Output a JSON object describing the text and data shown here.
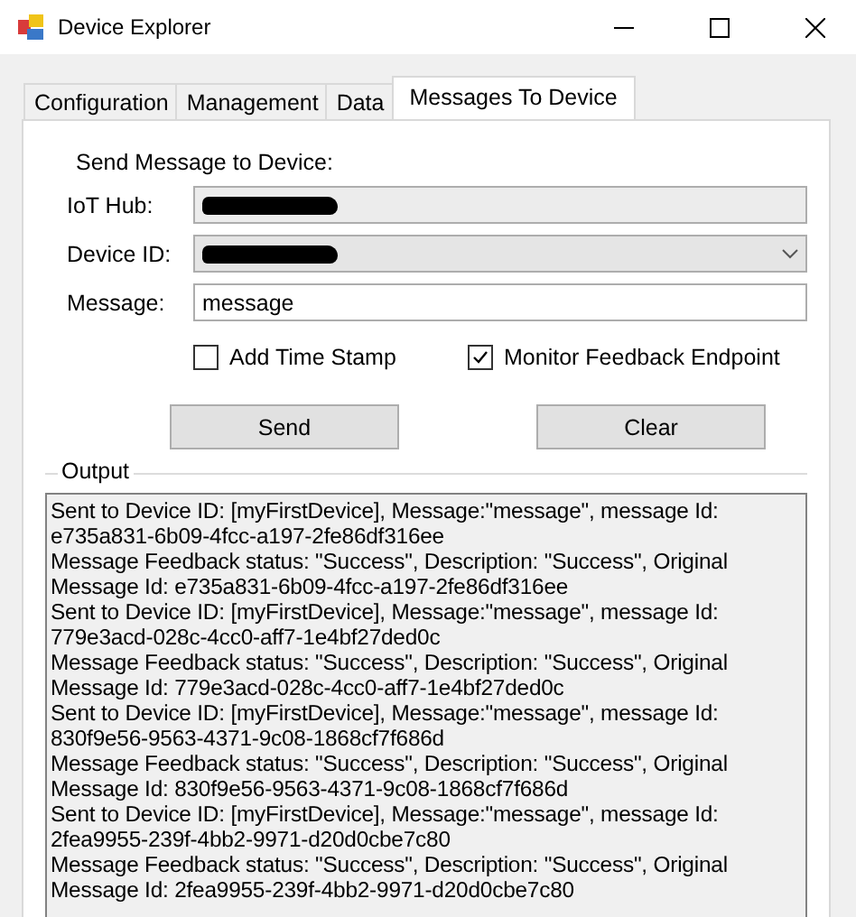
{
  "window": {
    "title": "Device Explorer"
  },
  "tabs": [
    {
      "label": "Configuration",
      "selected": false
    },
    {
      "label": "Management",
      "selected": false
    },
    {
      "label": "Data",
      "selected": false
    },
    {
      "label": "Messages To Device",
      "selected": true
    }
  ],
  "panel": {
    "heading": "Send Message to Device:",
    "fields": [
      {
        "label": "IoT Hub:",
        "kind": "readonly",
        "redacted": true
      },
      {
        "label": "Device ID:",
        "kind": "dropdown",
        "redacted": true
      },
      {
        "label": "Message:",
        "kind": "text",
        "value": "message"
      }
    ],
    "checkboxes": [
      {
        "label": "Add Time Stamp",
        "checked": false
      },
      {
        "label": "Monitor Feedback Endpoint",
        "checked": true
      }
    ],
    "buttons": [
      "Send",
      "Clear"
    ],
    "output": {
      "title": "Output",
      "lines": [
        "Sent to Device ID: [myFirstDevice], Message:\"message\", message Id:",
        "e735a831-6b09-4fcc-a197-2fe86df316ee",
        "Message Feedback status: \"Success\", Description: \"Success\", Original",
        "Message Id: e735a831-6b09-4fcc-a197-2fe86df316ee",
        "Sent to Device ID: [myFirstDevice], Message:\"message\", message Id:",
        "779e3acd-028c-4cc0-aff7-1e4bf27ded0c",
        "Message Feedback status: \"Success\", Description: \"Success\", Original",
        "Message Id: 779e3acd-028c-4cc0-aff7-1e4bf27ded0c",
        "Sent to Device ID: [myFirstDevice], Message:\"message\", message Id:",
        "830f9e56-9563-4371-9c08-1868cf7f686d",
        "Message Feedback status: \"Success\", Description: \"Success\", Original",
        "Message Id: 830f9e56-9563-4371-9c08-1868cf7f686d",
        "Sent to Device ID: [myFirstDevice], Message:\"message\", message Id:",
        "2fea9955-239f-4bb2-9971-d20d0cbe7c80",
        "Message Feedback status: \"Success\", Description: \"Success\", Original",
        "Message Id: 2fea9955-239f-4bb2-9971-d20d0cbe7c80"
      ]
    }
  }
}
